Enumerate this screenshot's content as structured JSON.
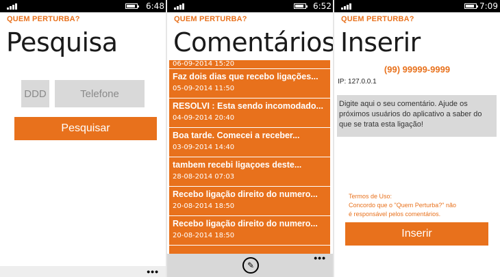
{
  "colors": {
    "accent": "#e8711c",
    "field_bg": "#d9d9d9",
    "statusbar": "#000000"
  },
  "screens": [
    {
      "time": "6:48",
      "app_title": "QUEM PERTURBA?",
      "page_title": "Pesquisa",
      "ddd_placeholder": "DDD",
      "phone_placeholder": "Telefone",
      "search_button": "Pesquisar",
      "more": "•••"
    },
    {
      "time": "6:52",
      "app_title": "QUEM PERTURBA?",
      "page_title": "Comentários",
      "comments": [
        {
          "text": "",
          "date": "06-09-2014 15:20"
        },
        {
          "text": "Faz dois dias que recebo ligações...",
          "date": "05-09-2014 11:50"
        },
        {
          "text": "RESOLVI : Esta sendo incomodado...",
          "date": "04-09-2014 20:40"
        },
        {
          "text": "Boa tarde. Comecei a receber...",
          "date": "03-09-2014 14:40"
        },
        {
          "text": "tambem recebi ligaçoes deste...",
          "date": "28-08-2014 07:03"
        },
        {
          "text": "Recebo ligação direito do numero...",
          "date": "20-08-2014 18:50"
        },
        {
          "text": "Recebo ligação direito do numero...",
          "date": "20-08-2014 18:50"
        }
      ],
      "more": "•••",
      "edit_icon": "pencil-icon"
    },
    {
      "time": "7:09",
      "app_title": "QUEM PERTURBA?",
      "page_title": "Inserir",
      "phone_number": "(99) 99999-9999",
      "ip": "IP: 127.0.0.1",
      "comment_placeholder": "Digite aqui o seu comentário. Ajude os próximos usuários do aplicativo a saber do que se trata esta ligação!",
      "terms_title": "Termos de Uso:",
      "terms_line1": "Concordo que o \"Quem Perturba?\" não",
      "terms_line2": "é responsável pelos comentários.",
      "insert_button": "Inserir"
    }
  ]
}
